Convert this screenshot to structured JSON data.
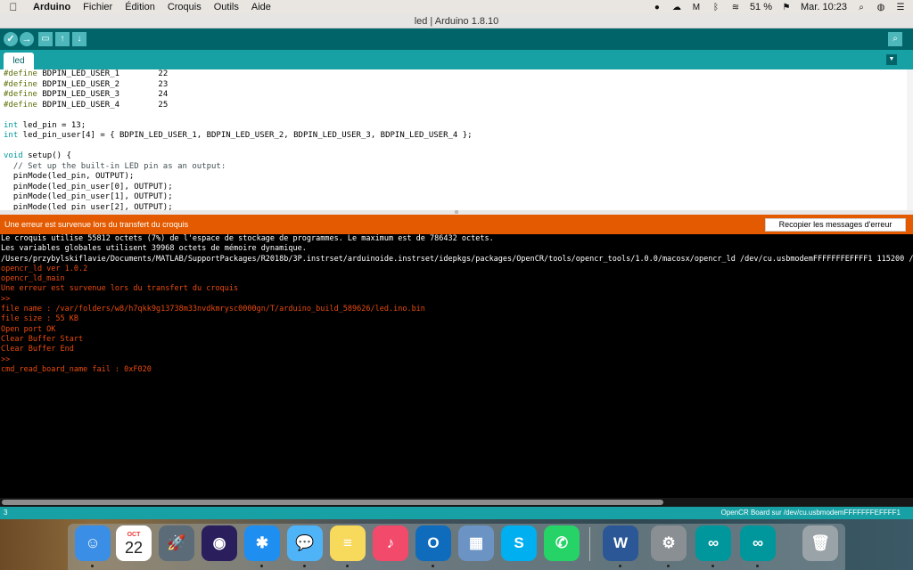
{
  "menubar": {
    "app_name": "Arduino",
    "menus": [
      "Fichier",
      "Édition",
      "Croquis",
      "Outils",
      "Aide"
    ],
    "battery": "51 %",
    "clock": "Mar. 10:23"
  },
  "window": {
    "title": "led | Arduino 1.8.10"
  },
  "toolbar": {
    "verify_icon": "check-icon",
    "upload_icon": "arrow-right-icon",
    "new_icon": "new-file-icon",
    "open_icon": "arrow-up-icon",
    "save_icon": "arrow-down-icon",
    "serial_icon": "magnifier-icon"
  },
  "tabs": [
    {
      "label": "led"
    }
  ],
  "editor": {
    "lines": [
      {
        "pre": "#define",
        "rest": " BDPIN_LED_USER_1        22"
      },
      {
        "pre": "#define",
        "rest": " BDPIN_LED_USER_2        23"
      },
      {
        "pre": "#define",
        "rest": " BDPIN_LED_USER_3        24"
      },
      {
        "pre": "#define",
        "rest": " BDPIN_LED_USER_4        25"
      },
      {
        "pre": "",
        "rest": ""
      },
      {
        "pre": "int",
        "rest": " led_pin = 13;"
      },
      {
        "pre": "int",
        "rest": " led_pin_user[4] = { BDPIN_LED_USER_1, BDPIN_LED_USER_2, BDPIN_LED_USER_3, BDPIN_LED_USER_4 };"
      },
      {
        "pre": "",
        "rest": ""
      },
      {
        "pre": "void",
        "rest": " setup() {"
      },
      {
        "pre": "",
        "rest": "  // Set up the built-in LED pin as an output:"
      },
      {
        "pre": "",
        "rest": "  pinMode(led_pin, OUTPUT);"
      },
      {
        "pre": "",
        "rest": "  pinMode(led_pin_user[0], OUTPUT);"
      },
      {
        "pre": "",
        "rest": "  pinMode(led_pin_user[1], OUTPUT);"
      },
      {
        "pre": "",
        "rest": "  pinMode(led_pin_user[2], OUTPUT);"
      }
    ]
  },
  "errorbar": {
    "message": "Une erreur est survenue lors du transfert du croquis",
    "copy_button": "Recopier les messages d'erreur"
  },
  "console": {
    "lines": [
      {
        "color": "white",
        "text": "Le croquis utilise 55812 octets (7%) de l'espace de stockage de programmes. Le maximum est de 786432 octets."
      },
      {
        "color": "white",
        "text": "Les variables globales utilisent 39968 octets de mémoire dynamique."
      },
      {
        "color": "white",
        "text": "/Users/przybylskiflavie/Documents/MATLAB/SupportPackages/R2018b/3P.instrset/arduinoide.instrset/idepkgs/packages/OpenCR/tools/opencr_tools/1.0.0/macosx/opencr_ld /dev/cu.usbmodemFFFFFFFEFFFF1 115200 /var/fo"
      },
      {
        "color": "orange",
        "text": "opencr_ld ver 1.0.2"
      },
      {
        "color": "orange",
        "text": "opencr_ld_main"
      },
      {
        "color": "orange",
        "text": "Une erreur est survenue lors du transfert du croquis"
      },
      {
        "color": "orange",
        "text": ">>"
      },
      {
        "color": "orange",
        "text": "file name : /var/folders/w8/h7qkk9g13738m33nvdkmrysc0000gn/T/arduino_build_589626/led.ino.bin"
      },
      {
        "color": "orange",
        "text": "file size : 55 KB"
      },
      {
        "color": "orange",
        "text": "Open port OK"
      },
      {
        "color": "orange",
        "text": "Clear Buffer Start"
      },
      {
        "color": "orange",
        "text": "Clear Buffer End"
      },
      {
        "color": "orange",
        "text": ">>"
      },
      {
        "color": "orange",
        "text": "cmd_read_board_name fail : 0xF020"
      }
    ]
  },
  "footer": {
    "line_number": "3",
    "board": "OpenCR Board sur /dev/cu.usbmodemFFFFFFFEFFFF1"
  },
  "dock": {
    "calendar_month": "OCT",
    "calendar_day": "22",
    "apps": [
      {
        "name": "finder-icon",
        "color": "#3a8ee6",
        "glyph": "☺"
      },
      {
        "name": "calendar-icon",
        "color": "#ffffff",
        "glyph": ""
      },
      {
        "name": "launchpad-icon",
        "color": "#5c6b78",
        "glyph": "🚀"
      },
      {
        "name": "siri-icon",
        "color": "#2a1e5c",
        "glyph": "◉"
      },
      {
        "name": "safari-icon",
        "color": "#1f8ef1",
        "glyph": "✱"
      },
      {
        "name": "messages-icon",
        "color": "#4fb3f7",
        "glyph": "💬"
      },
      {
        "name": "notes-icon",
        "color": "#f7d95c",
        "glyph": "≡"
      },
      {
        "name": "music-icon",
        "color": "#f24a6a",
        "glyph": "♪"
      },
      {
        "name": "outlook-icon",
        "color": "#0f6cbd",
        "glyph": "O"
      },
      {
        "name": "preview-icon",
        "color": "#6b94c4",
        "glyph": "▦"
      },
      {
        "name": "skype-icon",
        "color": "#00aff0",
        "glyph": "S"
      },
      {
        "name": "whatsapp-icon",
        "color": "#25d366",
        "glyph": "✆"
      },
      {
        "name": "word-icon",
        "color": "#2b5797",
        "glyph": "W"
      },
      {
        "name": "system-preferences-icon",
        "color": "#8a8f94",
        "glyph": "⚙"
      },
      {
        "name": "arduino-icon",
        "color": "#00979c",
        "glyph": "∞"
      },
      {
        "name": "arduino-icon",
        "color": "#00979c",
        "glyph": "∞"
      },
      {
        "name": "trash-icon",
        "color": "#9aa3a8",
        "glyph": "🗑"
      }
    ]
  }
}
